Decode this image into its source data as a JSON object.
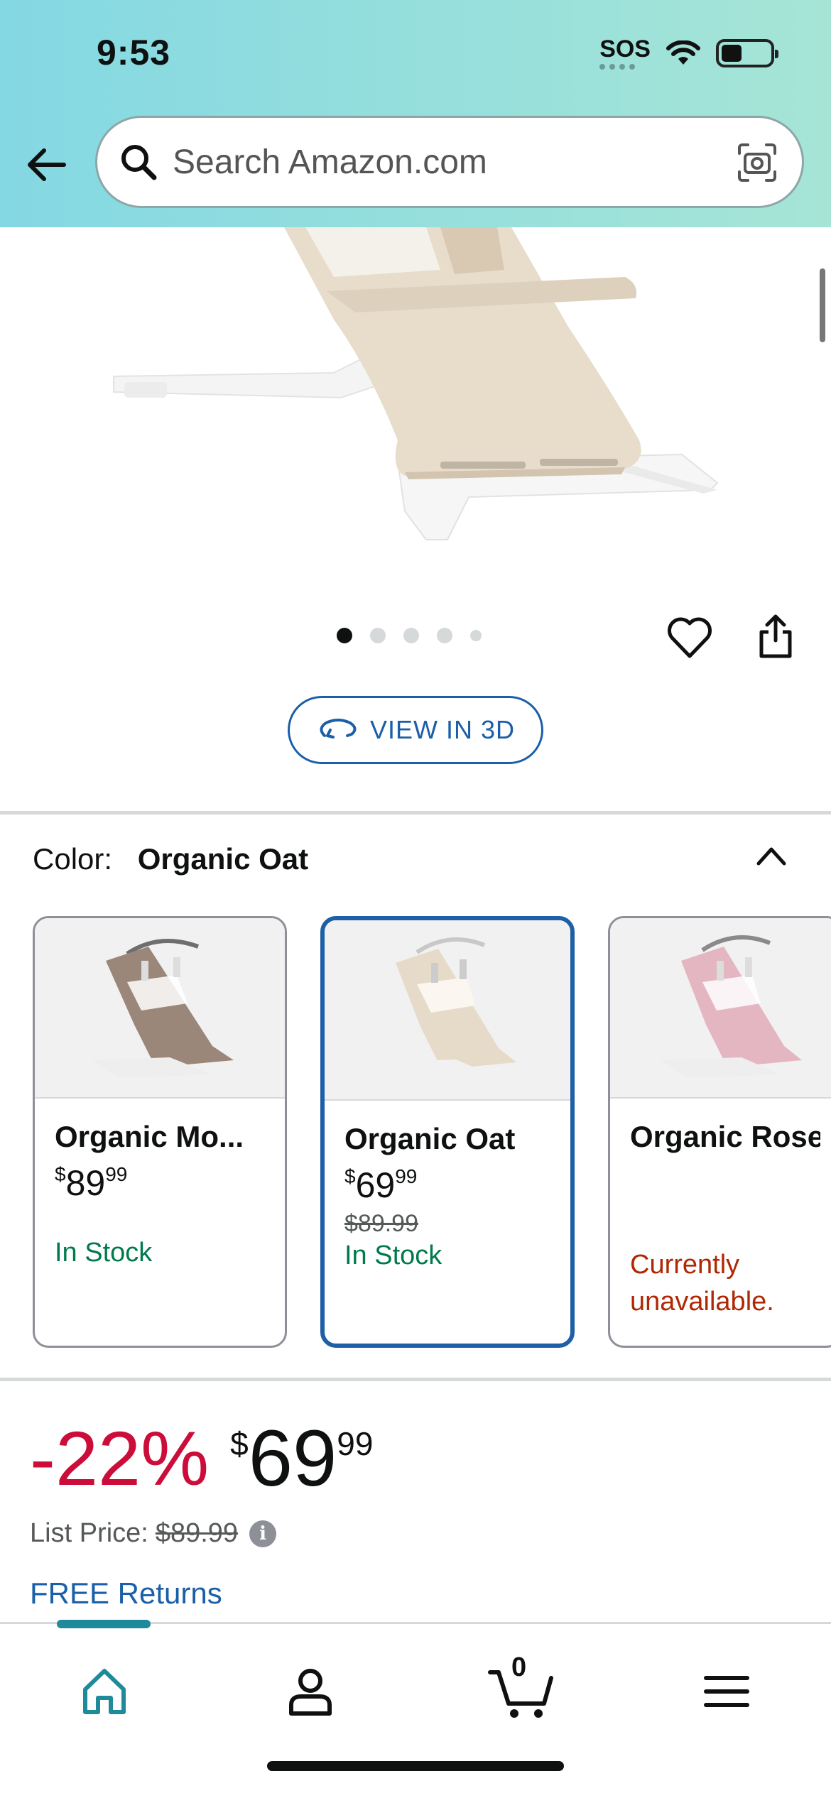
{
  "status_bar": {
    "time": "9:53",
    "sos": "SOS"
  },
  "search": {
    "placeholder": "Search Amazon.com"
  },
  "colors": {
    "accent_blue": "#1b5fa8",
    "deal_red": "#cc0c39",
    "stock_green": "#007a4d",
    "unavailable_red": "#b12704",
    "header_gradient_start": "#84d8e3",
    "header_gradient_end": "#a6e5d6"
  },
  "gallery": {
    "image_count": 5,
    "active_index": 0,
    "view3d_label": "VIEW IN 3D"
  },
  "color_selector": {
    "label": "Color:",
    "selected": "Organic Oat",
    "options": [
      {
        "name": "Organic Mo...",
        "price_whole": "89",
        "price_fraction": "99",
        "currency": "$",
        "list_price": "",
        "availability": "In Stock"
      },
      {
        "name": "Organic Oat",
        "price_whole": "69",
        "price_fraction": "99",
        "currency": "$",
        "list_price": "$89.99",
        "availability": "In Stock"
      },
      {
        "name": "Organic Rose",
        "availability": "Currently unavailable."
      }
    ]
  },
  "pricing": {
    "discount": "-22%",
    "currency": "$",
    "price_whole": "69",
    "price_fraction": "99",
    "list_price_label": "List Price:",
    "list_price": "$89.99",
    "info_icon": "i",
    "free_returns": "FREE Returns"
  },
  "tabbar": {
    "items": [
      "home-icon",
      "account-icon",
      "cart-icon",
      "menu-icon"
    ],
    "cart_count": "0",
    "active": "home"
  }
}
